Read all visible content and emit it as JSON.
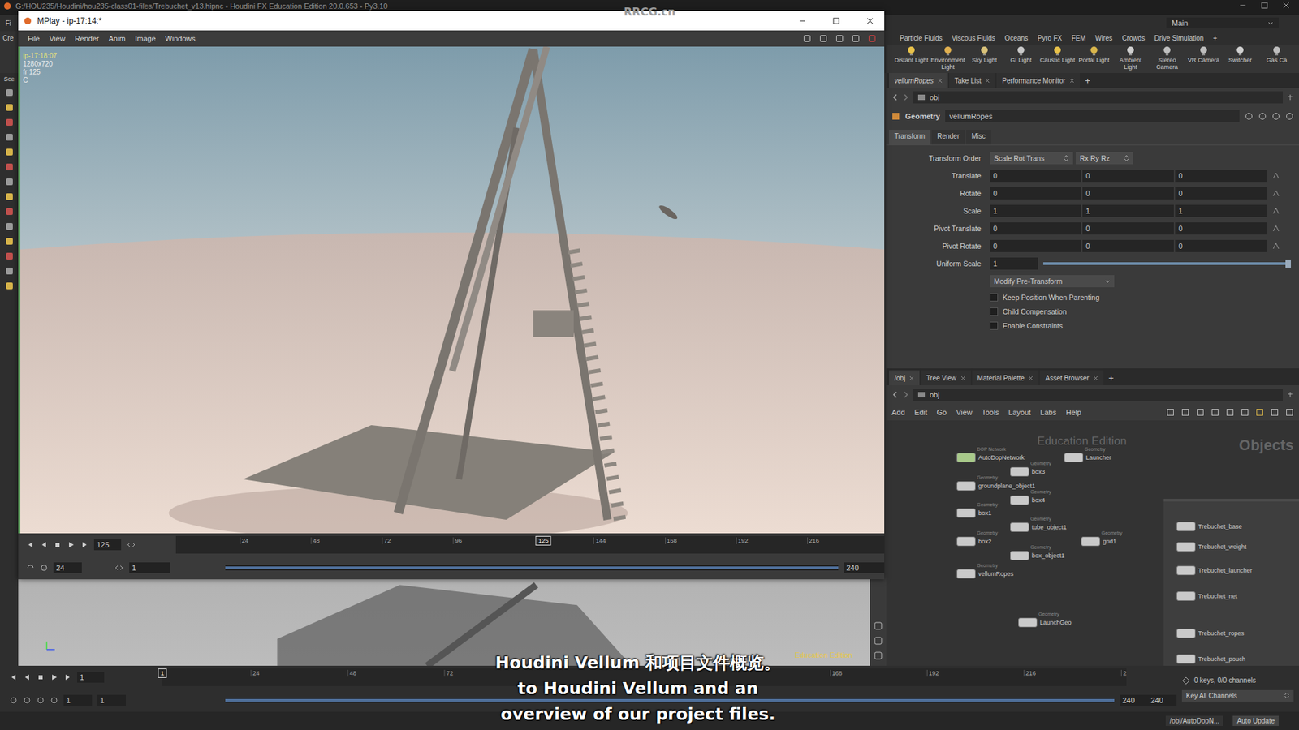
{
  "watermark": "RRCG.cn",
  "houdini": {
    "title": "G:/HOU235/Houdini/hou235-class01-files/Trebuchet_v13.hipnc - Houdini FX Education Edition 20.0.653 - Py3.10",
    "left_labels": [
      "Fi",
      "Cre",
      "Sce"
    ],
    "desktop": "Main",
    "shelf_tabs": [
      "Particle Fluids",
      "Viscous Fluids",
      "Oceans",
      "Pyro FX",
      "FEM",
      "Wires",
      "Crowds",
      "Drive Simulation",
      "+"
    ],
    "shelf_tools": [
      "Distant Light",
      "Environment Light",
      "Sky Light",
      "GI Light",
      "Caustic Light",
      "Portal Light",
      "Ambient Light",
      "Stereo Camera",
      "VR Camera",
      "Switcher",
      "Gas Ca"
    ],
    "viewport": {
      "badge": "Education Edition"
    },
    "parameters": {
      "tabs": [
        {
          "label": "vellumRopes",
          "selected": true
        },
        {
          "label": "Take List",
          "selected": false
        },
        {
          "label": "Performance Monitor",
          "selected": false
        }
      ],
      "add_tab": "+",
      "path": "obj",
      "node_type": "Geometry",
      "node_name": "vellumRopes",
      "sections": [
        {
          "label": "Transform",
          "selected": true
        },
        {
          "label": "Render",
          "selected": false
        },
        {
          "label": "Misc",
          "selected": false
        }
      ],
      "rows": [
        {
          "kind": "menus",
          "label": "Transform Order",
          "values": [
            "Scale Rot Trans",
            "Rx Ry Rz"
          ]
        },
        {
          "kind": "vector",
          "label": "Translate",
          "values": [
            "0",
            "0",
            "0"
          ]
        },
        {
          "kind": "vector",
          "label": "Rotate",
          "values": [
            "0",
            "0",
            "0"
          ]
        },
        {
          "kind": "vector",
          "label": "Scale",
          "values": [
            "1",
            "1",
            "1"
          ]
        },
        {
          "kind": "vector",
          "label": "Pivot Translate",
          "values": [
            "0",
            "0",
            "0"
          ]
        },
        {
          "kind": "vector",
          "label": "Pivot Rotate",
          "values": [
            "0",
            "0",
            "0"
          ]
        },
        {
          "kind": "slider",
          "label": "Uniform Scale",
          "values": [
            "1"
          ],
          "level": 1
        },
        {
          "kind": "button",
          "label": "",
          "values": [
            "Modify Pre-Transform"
          ]
        },
        {
          "kind": "checkbox",
          "label": "Keep Position When Parenting",
          "values": [],
          "checked": false
        },
        {
          "kind": "checkbox",
          "label": "Child Compensation",
          "values": [],
          "checked": false
        },
        {
          "kind": "checkbox",
          "label": "Enable Constraints",
          "values": [],
          "checked": false
        }
      ]
    },
    "network": {
      "tabs": [
        {
          "label": "/obj",
          "selected": true
        },
        {
          "label": "Tree View",
          "selected": false
        },
        {
          "label": "Material Palette",
          "selected": false
        },
        {
          "label": "Asset Browser",
          "selected": false
        }
      ],
      "add_tab": "+",
      "path": "obj",
      "menu": [
        "Add",
        "Edit",
        "Go",
        "View",
        "Tools",
        "Layout",
        "Labs",
        "Help"
      ],
      "watermark": "Education Edition",
      "context": "Objects",
      "nodes": [
        {
          "name": "AutoDopNetwork",
          "type": "DOP Network",
          "kind": "dop"
        },
        {
          "name": "Launcher",
          "type": "Geometry",
          "kind": "geo"
        },
        {
          "name": "box3",
          "type": "Geometry",
          "kind": "geo"
        },
        {
          "name": "groundplane_object1",
          "type": "Geometry",
          "kind": "geo"
        },
        {
          "name": "box4",
          "type": "Geometry",
          "kind": "geo"
        },
        {
          "name": "box1",
          "type": "Geometry",
          "kind": "geo"
        },
        {
          "name": "tube_object1",
          "type": "Geometry",
          "kind": "geo"
        },
        {
          "name": "grid1",
          "type": "Geometry",
          "kind": "geo"
        },
        {
          "name": "box2",
          "type": "Geometry",
          "kind": "geo"
        },
        {
          "name": "box_object1",
          "type": "Geometry",
          "kind": "geo"
        },
        {
          "name": "vellumRopes",
          "type": "Geometry",
          "kind": "geo"
        },
        {
          "name": "LaunchGeo",
          "type": "Geometry",
          "kind": "geo"
        }
      ],
      "box_nodes": [
        "Trebuchet_base",
        "Trebuchet_weight",
        "Trebuchet_launcher",
        "Trebuchet_net",
        "Trebuchet_ropes",
        "Trebuchet_pouch"
      ]
    },
    "timeline": {
      "frame": "1",
      "start": "1",
      "end": "240",
      "ticks": [
        "24",
        "48",
        "72",
        "168",
        "192",
        "216"
      ],
      "cut_label": "2",
      "range_start": [
        "1",
        "1"
      ],
      "range_end": [
        "240",
        "240"
      ]
    },
    "keys": {
      "summary": "0 keys, 0/0 channels",
      "button": "Key All Channels"
    },
    "status": {
      "path": "/obj/AutoDopN...",
      "update": "Auto Update"
    }
  },
  "mplay": {
    "title": "MPlay - ip-17:14:*",
    "menu": [
      "File",
      "View",
      "Render",
      "Anim",
      "Image",
      "Windows"
    ],
    "info": [
      "ip-17:18:07",
      "1280x720",
      "fr 125",
      "C"
    ],
    "timeline": {
      "frame": "125",
      "fps": "24",
      "start": "1",
      "end": "240",
      "ticks": [
        "24",
        "48",
        "72",
        "96",
        "144",
        "168",
        "192",
        "216"
      ]
    }
  },
  "subtitle": {
    "zh": "Houdini Vellum 和项目文件概览。",
    "en": [
      "to Houdini Vellum and an",
      "overview of our project files."
    ]
  }
}
